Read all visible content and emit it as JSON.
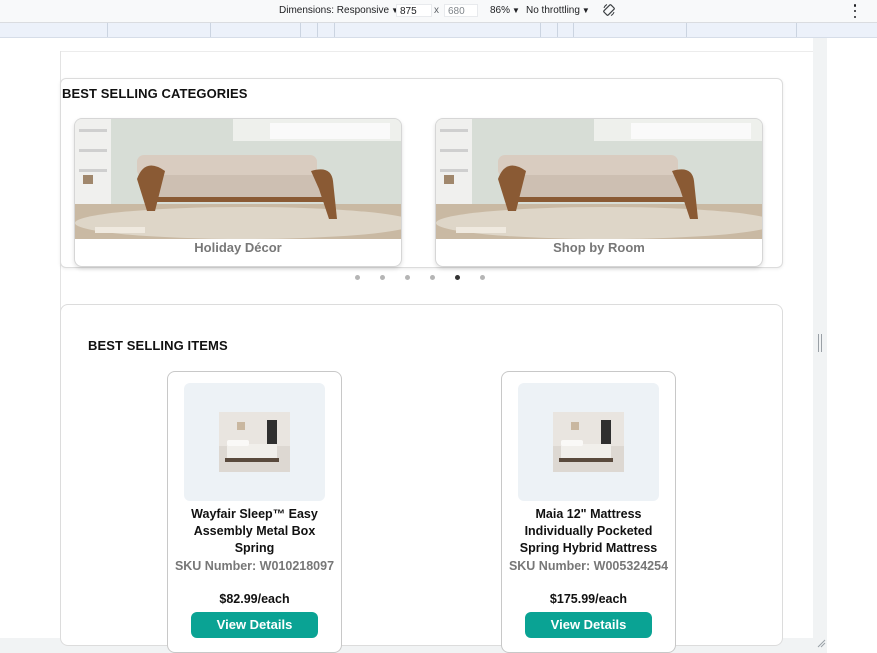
{
  "devtools": {
    "dimensions_label": "Dimensions: Responsive",
    "width_value": "875",
    "height_value": "680",
    "times": "x",
    "zoom_label": "86%",
    "throttling_label": "No throttling"
  },
  "categories": {
    "title": "BEST SELLING CATEGORIES",
    "tiles": [
      {
        "label": "Holiday Décor"
      },
      {
        "label": "Shop by Room"
      }
    ],
    "dots_count": 6,
    "active_dot_index": 4
  },
  "items": {
    "title": "BEST SELLING ITEMS",
    "products": [
      {
        "name": "Wayfair Sleep™ Easy Assembly Metal Box Spring",
        "sku": "SKU Number: W010218097",
        "price": "$82.99/each",
        "button": "View Details"
      },
      {
        "name": "Maia 12\" Mattress Individually Pocketed Spring Hybrid Mattress",
        "sku": "SKU Number: W005324254",
        "price": "$175.99/each",
        "button": "View Details"
      }
    ]
  },
  "colors": {
    "accent_button": "#0aa394",
    "active_dot": "#333333"
  }
}
